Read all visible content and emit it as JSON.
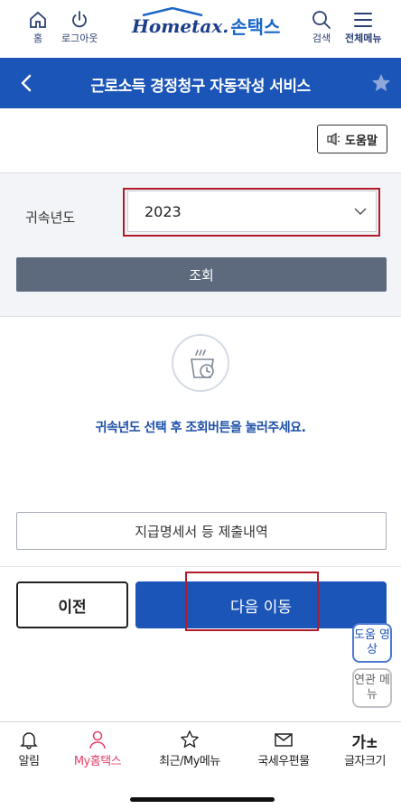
{
  "header": {
    "home_label": "홈",
    "logout_label": "로그아웃",
    "logo_en": "Hometax.",
    "logo_ko": "손택스",
    "search_label": "검색",
    "menu_label": "전체메뉴",
    "brand_color": "#1c55b8"
  },
  "titlebar": {
    "title": "근로소득 경정청구 자동작성 서비스"
  },
  "help": {
    "label": "도움말"
  },
  "filter": {
    "year_label": "귀속년도",
    "year_value": "2023",
    "search_label": "조회"
  },
  "empty_state": {
    "message": "귀속년도 선택 후 조회버튼을 눌러주세요."
  },
  "submit_history": {
    "label": "지급명세서 등 제출내역"
  },
  "actions": {
    "prev_label": "이전",
    "next_label": "다음 이동"
  },
  "floating": {
    "video_label": "도움 영상",
    "related_label": "연관 메뉴"
  },
  "bottom_nav": {
    "items": [
      {
        "label": "알림"
      },
      {
        "label": "My홈택스"
      },
      {
        "label": "최근/My메뉴"
      },
      {
        "label": "국세우편물"
      },
      {
        "label": "글자크기"
      }
    ],
    "font_glyph": "가±"
  },
  "icons": [
    "home-icon",
    "power-icon",
    "search-icon",
    "hamburger-icon",
    "chevron-left-icon",
    "star-icon",
    "speaker-icon",
    "chevron-down-icon",
    "cup-icon",
    "bell-icon",
    "person-icon",
    "star-outline-icon",
    "envelope-icon"
  ]
}
